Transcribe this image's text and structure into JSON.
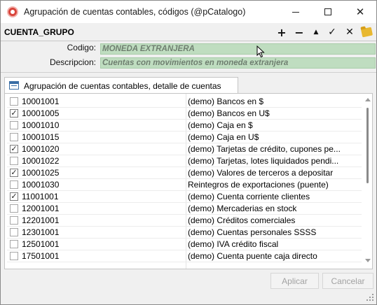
{
  "window": {
    "title": "Agrupación de cuentas contables, códigos (@pCatalogo)",
    "controls": {
      "minimize_icon": "minimize-icon",
      "maximize_icon": "maximize-icon",
      "close_icon": "close-icon",
      "close_glyph": "✕"
    }
  },
  "toolbar": {
    "title": "CUENTA_GRUPO",
    "add_glyph": "+",
    "remove_glyph": "−",
    "up_glyph": "▲",
    "confirm_glyph": "✓",
    "cancel_glyph": "✕"
  },
  "form": {
    "codigo_label": "Codigo:",
    "codigo_value": "MONEDA EXTRANJERA",
    "descripcion_label": "Descripcion:",
    "descripcion_value": "Cuentas con movimientos en moneda extranjera",
    "field_color": "#bfddc0"
  },
  "detail_tab": {
    "label": "Agrupación de cuentas contables, detalle de cuentas"
  },
  "rows": [
    {
      "checked": false,
      "mark": "",
      "code": "10001001",
      "desc": "(demo) Bancos en $"
    },
    {
      "checked": true,
      "mark": "✓",
      "code": "10001005",
      "desc": "(demo) Bancos en U$"
    },
    {
      "checked": false,
      "mark": "",
      "code": "10001010",
      "desc": "(demo) Caja en $"
    },
    {
      "checked": false,
      "mark": "",
      "code": "10001015",
      "desc": "(demo) Caja en U$"
    },
    {
      "checked": true,
      "mark": "✓",
      "code": "10001020",
      "desc": "(demo) Tarjetas de crédito, cupones pe..."
    },
    {
      "checked": false,
      "mark": "",
      "code": "10001022",
      "desc": "(demo) Tarjetas, lotes liquidados pendi..."
    },
    {
      "checked": true,
      "mark": "✓",
      "code": "10001025",
      "desc": "(demo) Valores de terceros a depositar"
    },
    {
      "checked": false,
      "mark": "",
      "code": "10001030",
      "desc": "Reintegros de exportaciones (puente)"
    },
    {
      "checked": true,
      "mark": "✓",
      "code": "11001001",
      "desc": "(demo) Cuenta corriente clientes"
    },
    {
      "checked": false,
      "mark": "",
      "code": "12001001",
      "desc": "(demo) Mercaderias en stock"
    },
    {
      "checked": false,
      "mark": "",
      "code": "12201001",
      "desc": "(demo) Créditos comerciales"
    },
    {
      "checked": false,
      "mark": "",
      "code": "12301001",
      "desc": "(demo) Cuentas personales SSSS"
    },
    {
      "checked": false,
      "mark": "",
      "code": "12501001",
      "desc": "(demo) IVA crédito fiscal"
    },
    {
      "checked": false,
      "mark": "",
      "code": "17501001",
      "desc": "(demo) Cuenta puente caja directo"
    }
  ],
  "buttons": {
    "apply": "Aplicar",
    "cancel": "Cancelar"
  }
}
